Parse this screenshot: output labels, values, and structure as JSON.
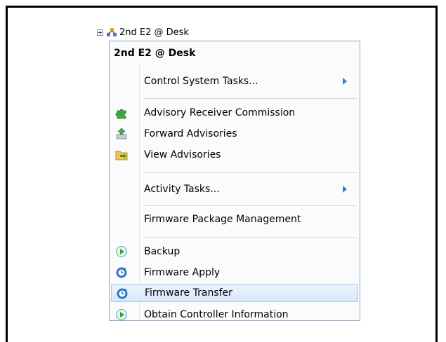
{
  "tree": {
    "node_label": "2nd E2 @ Desk"
  },
  "menu": {
    "header": "2nd E2 @ Desk",
    "items": [
      {
        "label": "Control System Tasks...",
        "submenu": true
      },
      {
        "label": "Advisory Receiver Commission"
      },
      {
        "label": "Forward Advisories"
      },
      {
        "label": "View Advisories"
      },
      {
        "label": "Activity Tasks...",
        "submenu": true
      },
      {
        "label": "Firmware Package Management"
      },
      {
        "label": "Backup"
      },
      {
        "label": "Firmware Apply"
      },
      {
        "label": "Firmware Transfer",
        "highlighted": true
      },
      {
        "label": "Obtain Controller Information"
      }
    ]
  },
  "colors": {
    "highlight": "#d8e8fb",
    "submenu_arrow": "#3a7bd5"
  }
}
